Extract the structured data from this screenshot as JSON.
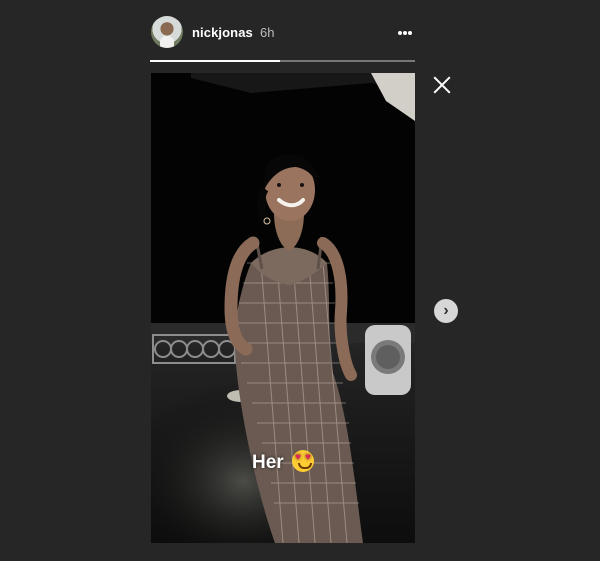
{
  "story": {
    "username": "nickjonas",
    "timestamp": "6h",
    "progress": 0.49,
    "caption_text": "Her",
    "caption_emoji": "heart-eyes-emoji"
  },
  "icons": {
    "more": "more-options-icon",
    "close": "close-icon",
    "next": "chevron-right-icon"
  },
  "colors": {
    "page_background": "#262626",
    "progress_track": "#777777",
    "progress_fill": "#ffffff",
    "next_button": "#d7d7d7"
  }
}
